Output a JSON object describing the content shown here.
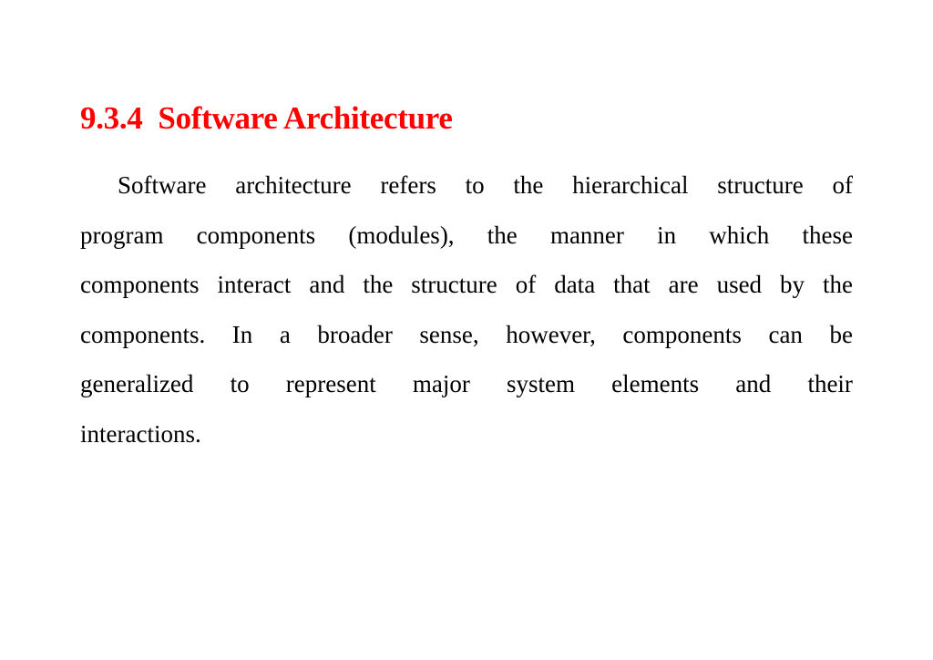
{
  "heading": {
    "number": "9.3.4",
    "title": "Software Architecture",
    "color": "#ff0000"
  },
  "paragraph": {
    "lines": [
      "Software architecture refers to the hierarchical structure of",
      "program components (modules), the manner in which these",
      "components interact and the structure of data that are used by the",
      "components. In a broader sense, however, components can be",
      "generalized to represent major system elements and their",
      "interactions."
    ]
  }
}
